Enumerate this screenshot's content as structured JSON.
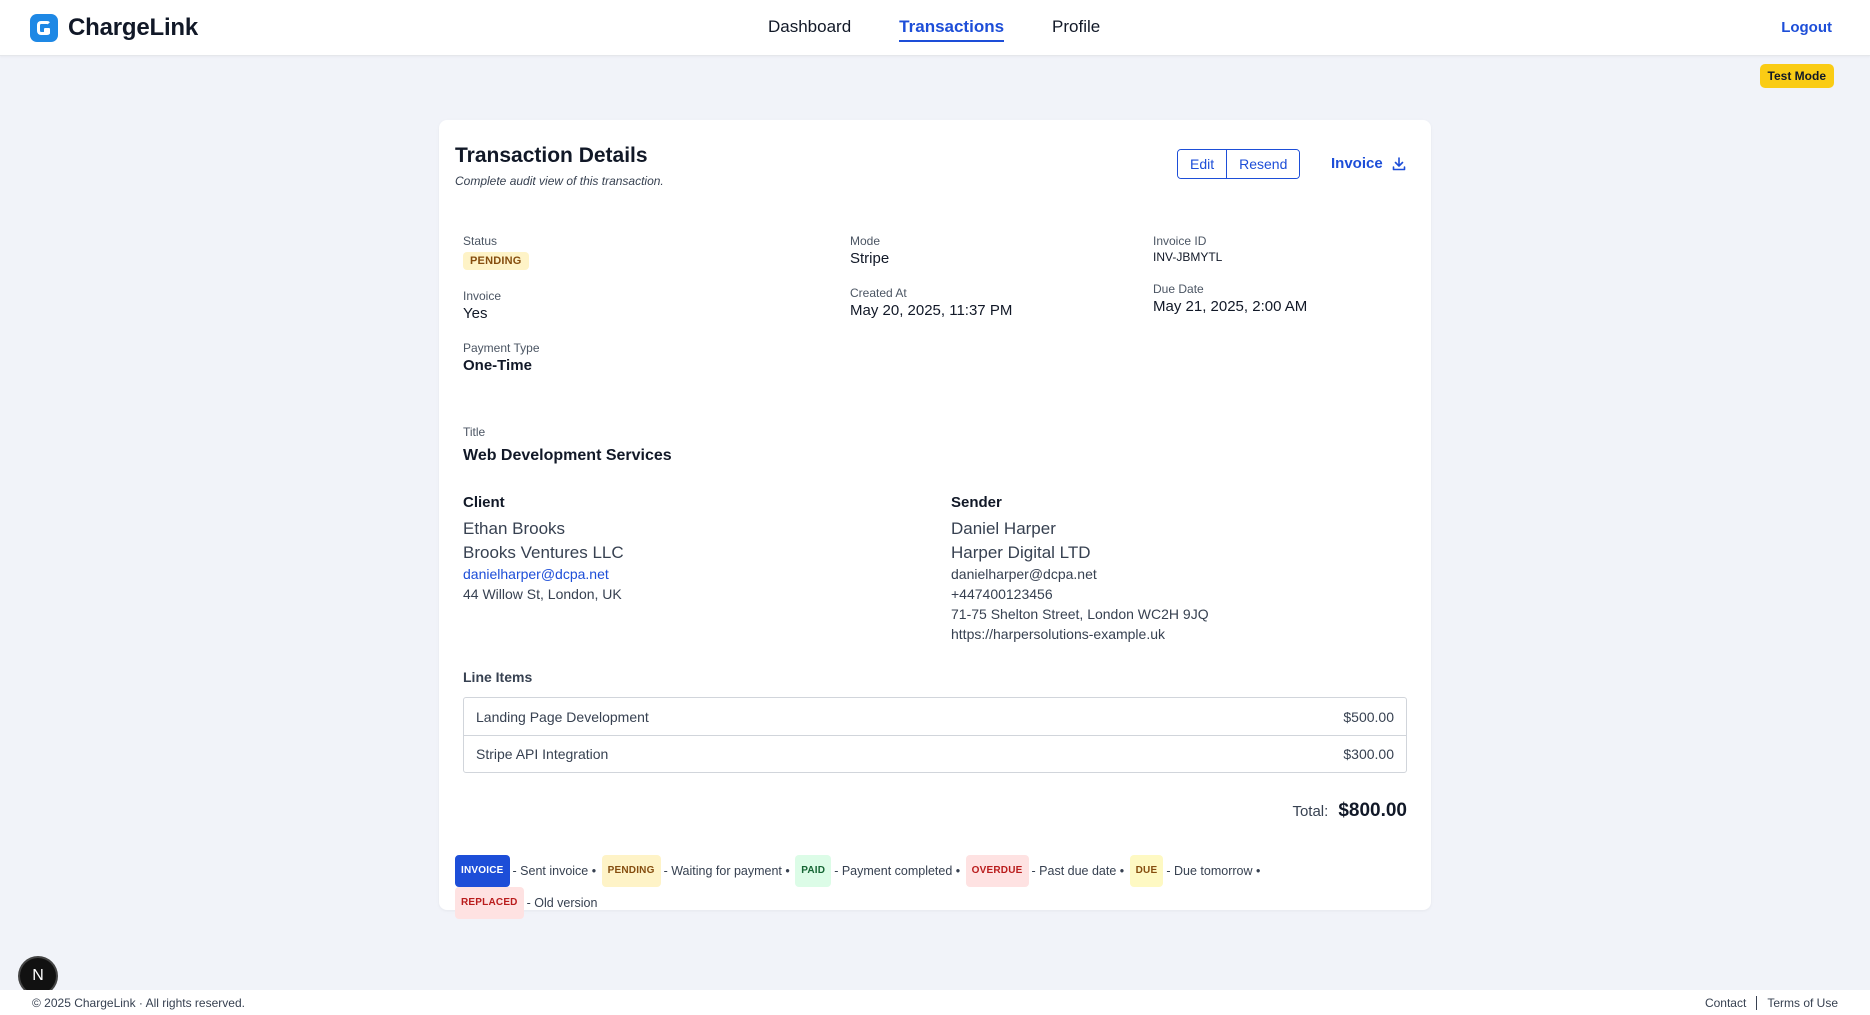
{
  "nav": {
    "brand": "ChargeLink",
    "links": [
      "Dashboard",
      "Transactions",
      "Profile"
    ],
    "active": "Transactions",
    "logout": "Logout"
  },
  "test_mode": "Test Mode",
  "card": {
    "title": "Transaction Details",
    "subtitle": "Complete audit view of this transaction.",
    "actions": {
      "edit": "Edit",
      "resend": "Resend",
      "invoice": "Invoice"
    }
  },
  "fields": {
    "status": {
      "label": "Status",
      "value": "PENDING"
    },
    "mode": {
      "label": "Mode",
      "value": "Stripe"
    },
    "invoice_id": {
      "label": "Invoice ID",
      "value": "INV-JBMYTL"
    },
    "invoice": {
      "label": "Invoice",
      "value": "Yes"
    },
    "created_at": {
      "label": "Created At",
      "value": "May 20, 2025, 11:37 PM"
    },
    "due_date": {
      "label": "Due Date",
      "value": "May 21, 2025, 2:00 AM"
    },
    "payment_type": {
      "label": "Payment Type",
      "value": "One-Time"
    },
    "title": {
      "label": "Title",
      "value": "Web Development Services"
    }
  },
  "client": {
    "heading": "Client",
    "name": "Ethan Brooks",
    "company": "Brooks Ventures LLC",
    "email": "danielharper@dcpa.net",
    "address": "44 Willow St, London, UK"
  },
  "sender": {
    "heading": "Sender",
    "name": "Daniel Harper",
    "company": "Harper Digital LTD",
    "email": "danielharper@dcpa.net",
    "phone": "+447400123456",
    "address": "71-75 Shelton Street, London WC2H 9JQ",
    "website": "https://harpersolutions-example.uk"
  },
  "line_items": {
    "heading": "Line Items",
    "items": [
      {
        "name": "Landing Page Development",
        "amount": "$500.00"
      },
      {
        "name": "Stripe API Integration",
        "amount": "$300.00"
      }
    ]
  },
  "total": {
    "label": "Total:",
    "value": "$800.00"
  },
  "legend": [
    {
      "badge": "INVOICE",
      "text": "- Sent invoice •"
    },
    {
      "badge": "PENDING",
      "text": "- Waiting for payment •"
    },
    {
      "badge": "PAID",
      "text": "- Payment completed •"
    },
    {
      "badge": "OVERDUE",
      "text": "- Past due date •"
    },
    {
      "badge": "DUE",
      "text": "- Due tomorrow •"
    },
    {
      "badge": "REPLACED",
      "text": "- Old version"
    }
  ],
  "footer": {
    "copyright": "© 2025 ChargeLink  ·  All rights reserved.",
    "contact": "Contact",
    "terms": "Terms of Use"
  },
  "dev_badge": "N"
}
